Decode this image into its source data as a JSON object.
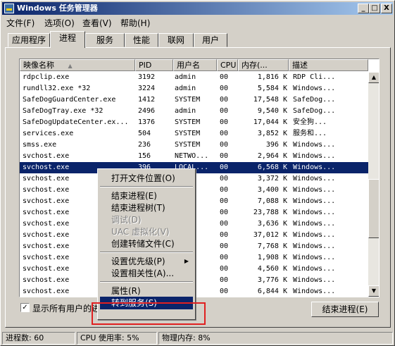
{
  "window": {
    "title": "Windows 任务管理器",
    "minimize": "_",
    "maximize": "□",
    "close": "X"
  },
  "menubar": [
    "文件(F)",
    "选项(O)",
    "查看(V)",
    "帮助(H)"
  ],
  "tabs": [
    "应用程序",
    "进程",
    "服务",
    "性能",
    "联网",
    "用户"
  ],
  "active_tab": "进程",
  "columns": [
    "映像名称",
    "PID",
    "用户名",
    "CPU",
    "内存(...",
    "描述"
  ],
  "rows": [
    {
      "name": "rdpclip.exe",
      "pid": "3192",
      "user": "admin",
      "cpu": "00",
      "mem": "1,816 K",
      "desc": "RDP Cli..."
    },
    {
      "name": "rundll32.exe *32",
      "pid": "3224",
      "user": "admin",
      "cpu": "00",
      "mem": "5,584 K",
      "desc": "Windows..."
    },
    {
      "name": "SafeDogGuardCenter.exe",
      "pid": "1412",
      "user": "SYSTEM",
      "cpu": "00",
      "mem": "17,548 K",
      "desc": "SafeDog..."
    },
    {
      "name": "SafeDogTray.exe *32",
      "pid": "2496",
      "user": "admin",
      "cpu": "00",
      "mem": "9,540 K",
      "desc": "SafeDog..."
    },
    {
      "name": "SafeDogUpdateCenter.ex...",
      "pid": "1376",
      "user": "SYSTEM",
      "cpu": "00",
      "mem": "17,044 K",
      "desc": "安全狗..."
    },
    {
      "name": "services.exe",
      "pid": "504",
      "user": "SYSTEM",
      "cpu": "00",
      "mem": "3,852 K",
      "desc": "服务和..."
    },
    {
      "name": "smss.exe",
      "pid": "236",
      "user": "SYSTEM",
      "cpu": "00",
      "mem": "396 K",
      "desc": "Windows..."
    },
    {
      "name": "svchost.exe",
      "pid": "156",
      "user": "NETWO...",
      "cpu": "00",
      "mem": "2,964 K",
      "desc": "Windows..."
    },
    {
      "name": "svchost.exe",
      "pid": "396",
      "user": "LOCAL...",
      "cpu": "00",
      "mem": "6,568 K",
      "desc": "Windows..."
    },
    {
      "name": "svchost.exe",
      "pid": "",
      "user": "M",
      "cpu": "00",
      "mem": "3,372 K",
      "desc": "Windows..."
    },
    {
      "name": "svchost.exe",
      "pid": "",
      "user": "...",
      "cpu": "00",
      "mem": "3,400 K",
      "desc": "Windows..."
    },
    {
      "name": "svchost.exe",
      "pid": "",
      "user": "...",
      "cpu": "00",
      "mem": "7,088 K",
      "desc": "Windows..."
    },
    {
      "name": "svchost.exe",
      "pid": "",
      "user": "M",
      "cpu": "00",
      "mem": "23,788 K",
      "desc": "Windows..."
    },
    {
      "name": "svchost.exe",
      "pid": "",
      "user": "M",
      "cpu": "00",
      "mem": "3,636 K",
      "desc": "Windows..."
    },
    {
      "name": "svchost.exe",
      "pid": "",
      "user": "M",
      "cpu": "00",
      "mem": "37,012 K",
      "desc": "Windows..."
    },
    {
      "name": "svchost.exe",
      "pid": "",
      "user": "...",
      "cpu": "00",
      "mem": "7,768 K",
      "desc": "Windows..."
    },
    {
      "name": "svchost.exe",
      "pid": "",
      "user": "...",
      "cpu": "00",
      "mem": "1,908 K",
      "desc": "Windows..."
    },
    {
      "name": "svchost.exe",
      "pid": "",
      "user": "M",
      "cpu": "00",
      "mem": "4,560 K",
      "desc": "Windows..."
    },
    {
      "name": "svchost.exe",
      "pid": "",
      "user": "M",
      "cpu": "00",
      "mem": "3,776 K",
      "desc": "Windows..."
    },
    {
      "name": "svchost.exe",
      "pid": "",
      "user": "M",
      "cpu": "00",
      "mem": "6,844 K",
      "desc": "Windows..."
    }
  ],
  "selected_row": 8,
  "context_menu": [
    {
      "label": "打开文件位置(O)",
      "state": "normal"
    },
    {
      "sep": true
    },
    {
      "label": "结束进程(E)",
      "state": "normal"
    },
    {
      "label": "结束进程树(T)",
      "state": "normal"
    },
    {
      "label": "调试(D)",
      "state": "disabled"
    },
    {
      "label": "UAC 虚拟化(V)",
      "state": "disabled"
    },
    {
      "label": "创建转储文件(C)",
      "state": "normal"
    },
    {
      "sep": true
    },
    {
      "label": "设置优先级(P)",
      "state": "normal",
      "submenu": true
    },
    {
      "label": "设置相关性(A)...",
      "state": "normal"
    },
    {
      "sep": true
    },
    {
      "label": "属性(R)",
      "state": "normal"
    },
    {
      "label": "转到服务(S)",
      "state": "highlighted"
    }
  ],
  "show_all_label": "显示所有用户的进",
  "show_all_checked": "✓",
  "end_process_button": "结束进程(E)",
  "status": {
    "processes": "进程数: 60",
    "cpu": "CPU 使用率: 5%",
    "memory": "物理内存: 8%"
  },
  "colors": {
    "highlight": "#0a246a",
    "callout": "#e02020"
  }
}
